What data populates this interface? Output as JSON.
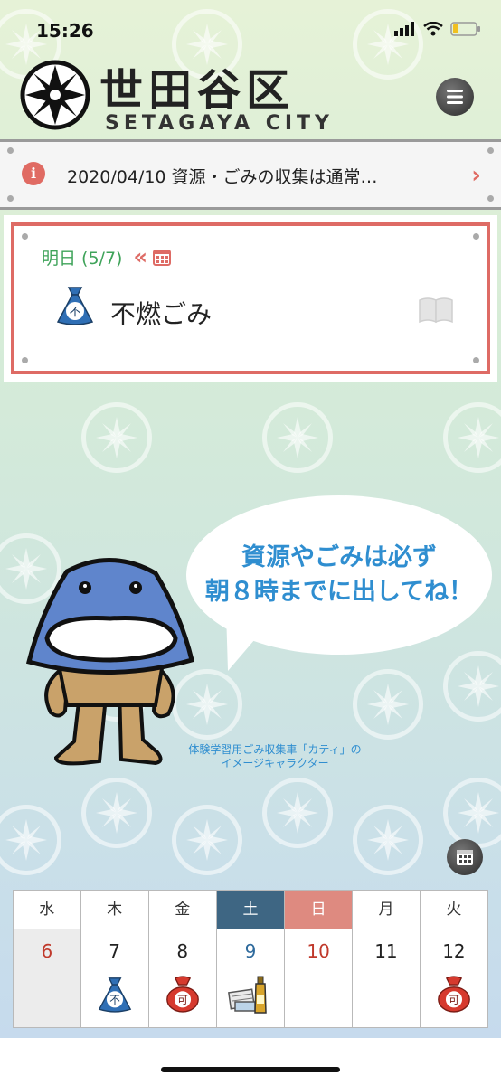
{
  "status": {
    "time": "15:26"
  },
  "header": {
    "title_ja": "世田谷区",
    "title_en": "SETAGAYA CITY"
  },
  "news": {
    "info_glyph": "i",
    "text": "2020/04/10 資源・ごみの収集は通常…",
    "chevron": "›"
  },
  "tomorrow": {
    "label": "明日 (5/7)",
    "prev_glyph": "«",
    "garbage": "不燃ごみ"
  },
  "bubble": {
    "line1": "資源やごみは必ず",
    "line2": "朝８時までに出してね！"
  },
  "caption": {
    "line1": "体験学習用ごみ収集車「カティ」の",
    "line2": "イメージキャラクター"
  },
  "calendar": {
    "weekdays": [
      "水",
      "木",
      "金",
      "土",
      "日",
      "月",
      "火"
    ],
    "days": [
      "6",
      "7",
      "8",
      "9",
      "10",
      "11",
      "12"
    ]
  },
  "icons": {
    "burnable_bag_label": "可",
    "nonburnable_bag_label": "不"
  },
  "colors": {
    "accent_red": "#de6b65",
    "accent_green": "#3fa35a",
    "saturday": "#3e6683",
    "sunday": "#de8a80",
    "text_blue": "#2f8ed0"
  }
}
